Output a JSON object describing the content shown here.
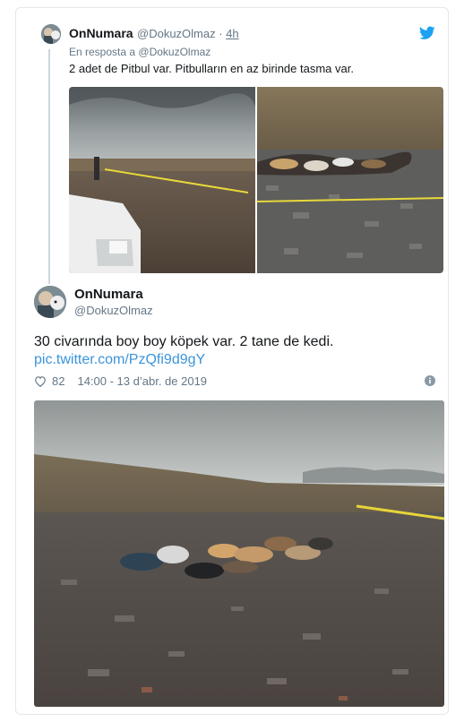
{
  "quoted": {
    "name": "OnNumara",
    "handle": "@DokuzOlmaz",
    "separator": "·",
    "time": "4h",
    "reply_prefix": "En resposta a",
    "reply_handle": "@DokuzOlmaz",
    "text": "2 adet de Pitbul var. Pitbulların en az birinde tasma var."
  },
  "tweet": {
    "name": "OnNumara",
    "handle": "@DokuzOlmaz",
    "text": "30 civarında boy boy köpek var. 2 tane de kedi.",
    "link": "pic.twitter.com/PzQfi9d9gY",
    "likes": "82",
    "timestamp": "14:00 - 13 d’abr. de 2019"
  },
  "icons": {
    "brand": "twitter-bird-icon",
    "like": "heart-icon",
    "info": "info-icon"
  },
  "colors": {
    "twitter_blue": "#1da1f2",
    "link_blue": "#3b94d9",
    "muted": "#657786",
    "border": "#e1e8ed"
  }
}
